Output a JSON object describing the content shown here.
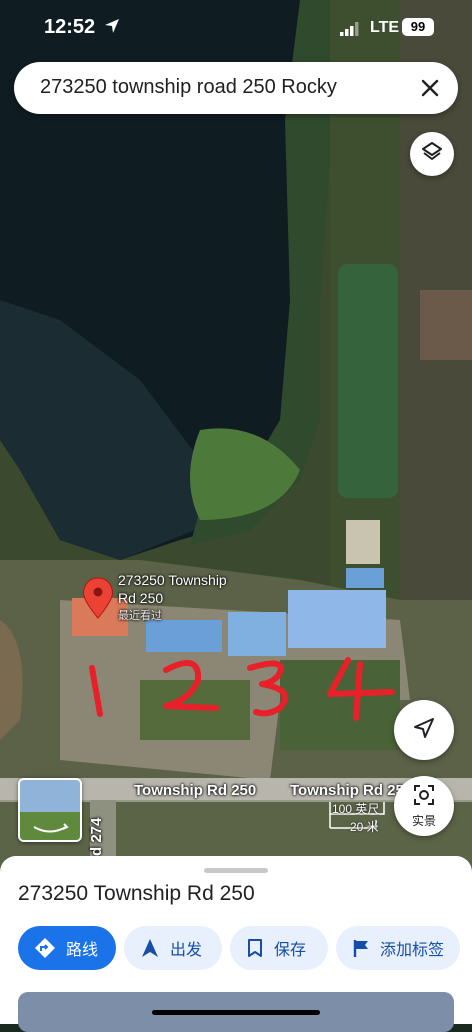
{
  "status": {
    "time": "12:52",
    "network": "LTE",
    "battery": "99"
  },
  "search": {
    "query": "273250 township road 250 Rocky"
  },
  "map": {
    "pin_title": "273250 Township Rd 250",
    "pin_subtitle": "最近看过",
    "road_labels": [
      "Township Rd 250",
      "Township Rd 250",
      "d 274"
    ],
    "scale_top": "100 英尺",
    "scale_bottom": "20 米",
    "annotations": [
      "1",
      "2",
      "3",
      "4"
    ],
    "live_view_label": "实景"
  },
  "sheet": {
    "title": "273250 Township Rd 250",
    "actions": {
      "route": "路线",
      "start": "出发",
      "save": "保存",
      "add_label": "添加标签"
    }
  },
  "colors": {
    "accent": "#1a73e8",
    "pin": "#ea4335",
    "annotation": "#e8202a"
  }
}
